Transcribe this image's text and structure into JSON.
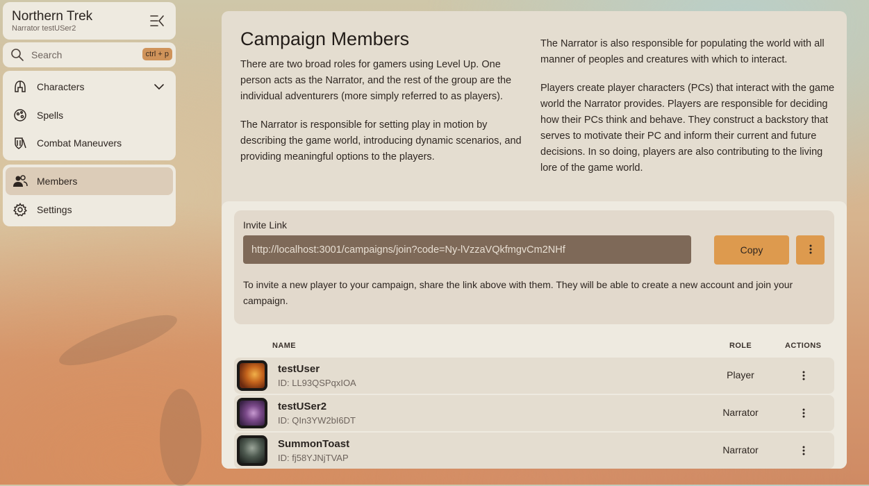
{
  "app": {
    "title": "Northern Trek",
    "subtitle": "Narrator testUSer2"
  },
  "search": {
    "placeholder": "Search",
    "shortcut": "ctrl + p"
  },
  "nav": {
    "group1": [
      {
        "label": "Characters",
        "icon": "helmet-icon",
        "expandable": true
      },
      {
        "label": "Spells",
        "icon": "spell-icon"
      },
      {
        "label": "Combat Maneuvers",
        "icon": "shield-icon"
      }
    ],
    "group2": [
      {
        "label": "Members",
        "icon": "members-icon",
        "active": true
      },
      {
        "label": "Settings",
        "icon": "gear-icon"
      }
    ]
  },
  "page": {
    "title": "Campaign Members",
    "left_paragraphs": [
      "There are two broad roles for gamers using Level Up. One person acts as the Narrator, and the rest of the group are the individual adventurers (more simply referred to as players).",
      "The Narrator is responsible for setting play in motion by describing the game world, introducing dynamic scenarios, and providing meaningful options to the players."
    ],
    "right_paragraphs": [
      "The Narrator is also responsible for populating the world with all manner of peoples and creatures with which to interact.",
      "Players create player characters (PCs) that interact with the game world the Narrator provides. Players are responsible for deciding how their PCs think and behave. They construct a backstory that serves to motivate their PC and inform their current and future decisions. In so doing, players are also contributing to the living lore of the game world."
    ]
  },
  "invite": {
    "label": "Invite Link",
    "url": "http://localhost:3001/campaigns/join?code=Ny-lVzzaVQkfmgvCm2NHf",
    "copy_label": "Copy",
    "help": "To invite a new player to your campaign, share the link above with them. They will be able to create a new account and join your campaign."
  },
  "table": {
    "headers": {
      "name": "NAME",
      "role": "ROLE",
      "actions": "ACTIONS"
    },
    "rows": [
      {
        "name": "testUser",
        "id": "ID: LL93QSPqxIOA",
        "role": "Player"
      },
      {
        "name": "testUSer2",
        "id": "ID: QIn3YW2bI6DT",
        "role": "Narrator"
      },
      {
        "name": "SummonToast",
        "id": "ID: fj58YJNjTVAP",
        "role": "Narrator"
      }
    ]
  },
  "colors": {
    "accent": "#dd9a4e",
    "active_nav": "#dcccb8",
    "link_field": "#7e6958"
  }
}
